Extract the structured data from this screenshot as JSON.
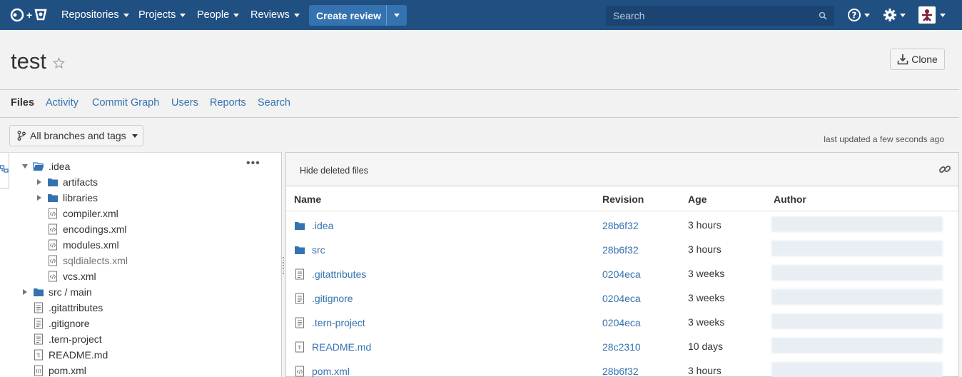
{
  "nav": {
    "items": [
      "Repositories",
      "Projects",
      "People",
      "Reviews"
    ],
    "create_label": "Create review",
    "search_placeholder": "Search"
  },
  "repo": {
    "title": "test",
    "clone_label": "Clone"
  },
  "tabs": [
    "Files",
    "Activity",
    "Commit Graph",
    "Users",
    "Reports",
    "Search"
  ],
  "branch_label": "All branches and tags",
  "last_updated": "last updated a few seconds ago",
  "tree": [
    {
      "label": ".idea",
      "type": "folder-open",
      "level": 0,
      "arrow": "down"
    },
    {
      "label": "artifacts",
      "type": "folder",
      "level": 1,
      "arrow": "right"
    },
    {
      "label": "libraries",
      "type": "folder",
      "level": 1,
      "arrow": "right"
    },
    {
      "label": "compiler.xml",
      "type": "xml",
      "level": 1
    },
    {
      "label": "encodings.xml",
      "type": "xml",
      "level": 1
    },
    {
      "label": "modules.xml",
      "type": "xml",
      "level": 1
    },
    {
      "label": "sqldialects.xml",
      "type": "xml",
      "level": 1,
      "muted": true
    },
    {
      "label": "vcs.xml",
      "type": "xml",
      "level": 1
    },
    {
      "label": "src / main",
      "type": "folder",
      "level": 0,
      "arrow": "right"
    },
    {
      "label": ".gitattributes",
      "type": "doc",
      "level": 0
    },
    {
      "label": ".gitignore",
      "type": "doc",
      "level": 0
    },
    {
      "label": ".tern-project",
      "type": "doc",
      "level": 0
    },
    {
      "label": "README.md",
      "type": "md",
      "level": 0
    },
    {
      "label": "pom.xml",
      "type": "xml",
      "level": 0
    }
  ],
  "files_panel": {
    "hide_deleted_label": "Hide deleted files",
    "columns": {
      "name": "Name",
      "revision": "Revision",
      "age": "Age",
      "author": "Author"
    },
    "rows": [
      {
        "name": ".idea",
        "type": "folder",
        "revision": "28b6f32",
        "age": "3 hours"
      },
      {
        "name": "src",
        "type": "folder",
        "revision": "28b6f32",
        "age": "3 hours"
      },
      {
        "name": ".gitattributes",
        "type": "doc",
        "revision": "0204eca",
        "age": "3 weeks"
      },
      {
        "name": ".gitignore",
        "type": "doc",
        "revision": "0204eca",
        "age": "3 weeks"
      },
      {
        "name": ".tern-project",
        "type": "doc",
        "revision": "0204eca",
        "age": "3 weeks"
      },
      {
        "name": "README.md",
        "type": "md",
        "revision": "28c2310",
        "age": "10 days"
      },
      {
        "name": "pom.xml",
        "type": "xml",
        "revision": "28b6f32",
        "age": "3 hours"
      }
    ]
  },
  "colors": {
    "navbar": "#205081",
    "accent": "#3572b0",
    "folder": "#3572b0"
  }
}
